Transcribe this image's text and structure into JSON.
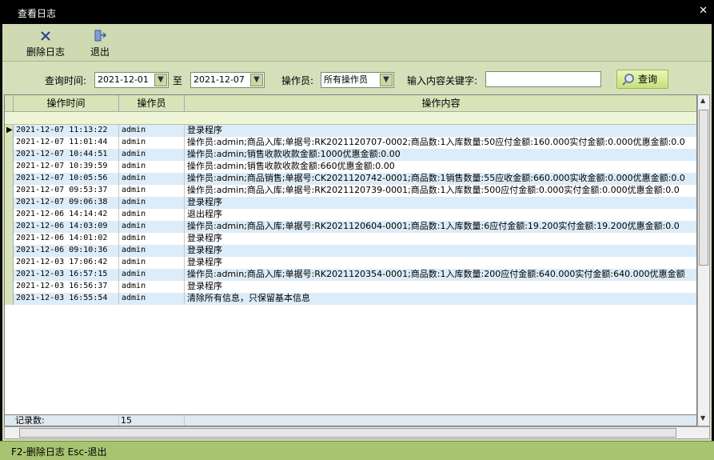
{
  "window": {
    "title": "查看日志",
    "close_icon": "close-icon"
  },
  "toolbar": {
    "delete_label": "删除日志",
    "exit_label": "退出"
  },
  "filters": {
    "time_label": "查询时间:",
    "date_from": "2021-12-01",
    "to_label": "至",
    "date_to": "2021-12-07",
    "operator_label": "操作员:",
    "operator_value": "所有操作员",
    "keyword_label": "输入内容关键字:",
    "keyword_value": "",
    "query_label": "查询"
  },
  "table": {
    "columns": [
      "操作时间",
      "操作员",
      "操作内容"
    ],
    "rows": [
      {
        "time": "2021-12-07 11:13:22",
        "operator": "admin",
        "content": "登录程序"
      },
      {
        "time": "2021-12-07 11:01:44",
        "operator": "admin",
        "content": "操作员:admin;商品入库;单据号:RK2021120707-0002;商品数:1入库数量:50应付金额:160.000实付金额:0.000优惠金额:0.0"
      },
      {
        "time": "2021-12-07 10:44:51",
        "operator": "admin",
        "content": "操作员:admin;销售收款收款金额:1000优惠金额:0.00"
      },
      {
        "time": "2021-12-07 10:39:59",
        "operator": "admin",
        "content": "操作员:admin;销售收款收款金额:660优惠金额:0.00"
      },
      {
        "time": "2021-12-07 10:05:56",
        "operator": "admin",
        "content": "操作员:admin;商品销售;单据号:CK2021120742-0001;商品数:1销售数量:55应收金额:660.000实收金额:0.000优惠金额:0.0"
      },
      {
        "time": "2021-12-07 09:53:37",
        "operator": "admin",
        "content": "操作员:admin;商品入库;单据号:RK2021120739-0001;商品数:1入库数量:500应付金额:0.000实付金额:0.000优惠金额:0.0"
      },
      {
        "time": "2021-12-07 09:06:38",
        "operator": "admin",
        "content": "登录程序"
      },
      {
        "time": "2021-12-06 14:14:42",
        "operator": "admin",
        "content": "退出程序"
      },
      {
        "time": "2021-12-06 14:03:09",
        "operator": "admin",
        "content": "操作员:admin;商品入库;单据号:RK2021120604-0001;商品数:1入库数量:6应付金额:19.200实付金额:19.200优惠金额:0.0"
      },
      {
        "time": "2021-12-06 14:01:02",
        "operator": "admin",
        "content": "登录程序"
      },
      {
        "time": "2021-12-06 09:10:36",
        "operator": "admin",
        "content": "登录程序"
      },
      {
        "time": "2021-12-03 17:06:42",
        "operator": "admin",
        "content": "登录程序"
      },
      {
        "time": "2021-12-03 16:57:15",
        "operator": "admin",
        "content": "操作员:admin;商品入库;单据号:RK2021120354-0001;商品数:1入库数量:200应付金额:640.000实付金额:640.000优惠金额"
      },
      {
        "time": "2021-12-03 16:56:37",
        "operator": "admin",
        "content": "登录程序"
      },
      {
        "time": "2021-12-03 16:55:54",
        "operator": "admin",
        "content": "清除所有信息，只保留基本信息"
      }
    ],
    "footer_label": "记录数:",
    "footer_count": "15"
  },
  "status": {
    "text": "F2-删除日志 Esc-退出"
  },
  "colors": {
    "row_alt": "#dcecf8",
    "row_plain": "#ffffff",
    "frame": "#d3deb8",
    "status": "#a8c470"
  }
}
